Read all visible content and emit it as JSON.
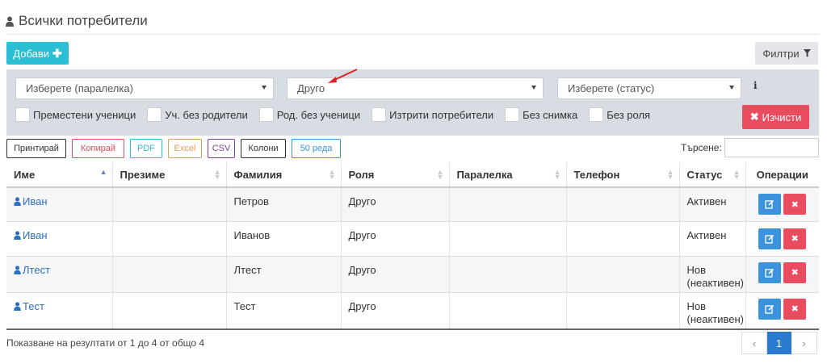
{
  "page": {
    "title": "Всички потребители"
  },
  "toolbar": {
    "add_label": "Добави",
    "filters_label": "Филтри"
  },
  "filters": {
    "class_select": "Изберете (паралелка)",
    "role_select": "Друго",
    "status_select": "Изберете (статус)",
    "info": "i",
    "checkboxes": [
      "Преместени ученици",
      "Уч. без родители",
      "Род. без ученици",
      "Изтрити потребители",
      "Без снимка",
      "Без роля"
    ],
    "clear_label": "Изчисти"
  },
  "export": {
    "buttons": [
      {
        "label": "Принтирай",
        "color": "#333333"
      },
      {
        "label": "Копирай",
        "color": "#e84c5e"
      },
      {
        "label": "PDF",
        "color": "#2cbfd4"
      },
      {
        "label": "Excel",
        "color": "#d9a05b"
      },
      {
        "label": "CSV",
        "color": "#7b3f9e"
      },
      {
        "label": "Колони",
        "color": "#333333"
      },
      {
        "label": "50 реда",
        "color": "#3b93db"
      }
    ],
    "search_label": "Търсене:",
    "search_value": ""
  },
  "table": {
    "headers": [
      "Име",
      "Презиме",
      "Фамилия",
      "Роля",
      "Паралелка",
      "Телефон",
      "Статус",
      "Операции"
    ],
    "rows": [
      {
        "name": "Иван",
        "middle": "",
        "family": "Петров",
        "role": "Друго",
        "class": "",
        "phone": "",
        "status": "Активен"
      },
      {
        "name": "Иван",
        "middle": "",
        "family": "Иванов",
        "role": "Друго",
        "class": "",
        "phone": "",
        "status": "Активен"
      },
      {
        "name": "Лтест",
        "middle": "",
        "family": "Лтест",
        "role": "Друго",
        "class": "",
        "phone": "",
        "status": "Нов (неактивен)"
      },
      {
        "name": "Тест",
        "middle": "",
        "family": "Тест",
        "role": "Друго",
        "class": "",
        "phone": "",
        "status": "Нов (неактивен)"
      }
    ],
    "delete_glyph": "✖"
  },
  "footer": {
    "results_text": "Показване на резултати от 1 до 4 от общо 4",
    "pager": {
      "prev": "‹",
      "current": "1",
      "next": "›"
    }
  },
  "colors": {
    "accent": "#2cbfd4",
    "danger": "#e84c5e",
    "primary": "#3b93db",
    "link": "#2a6fbf",
    "panel": "#d8dde4"
  }
}
